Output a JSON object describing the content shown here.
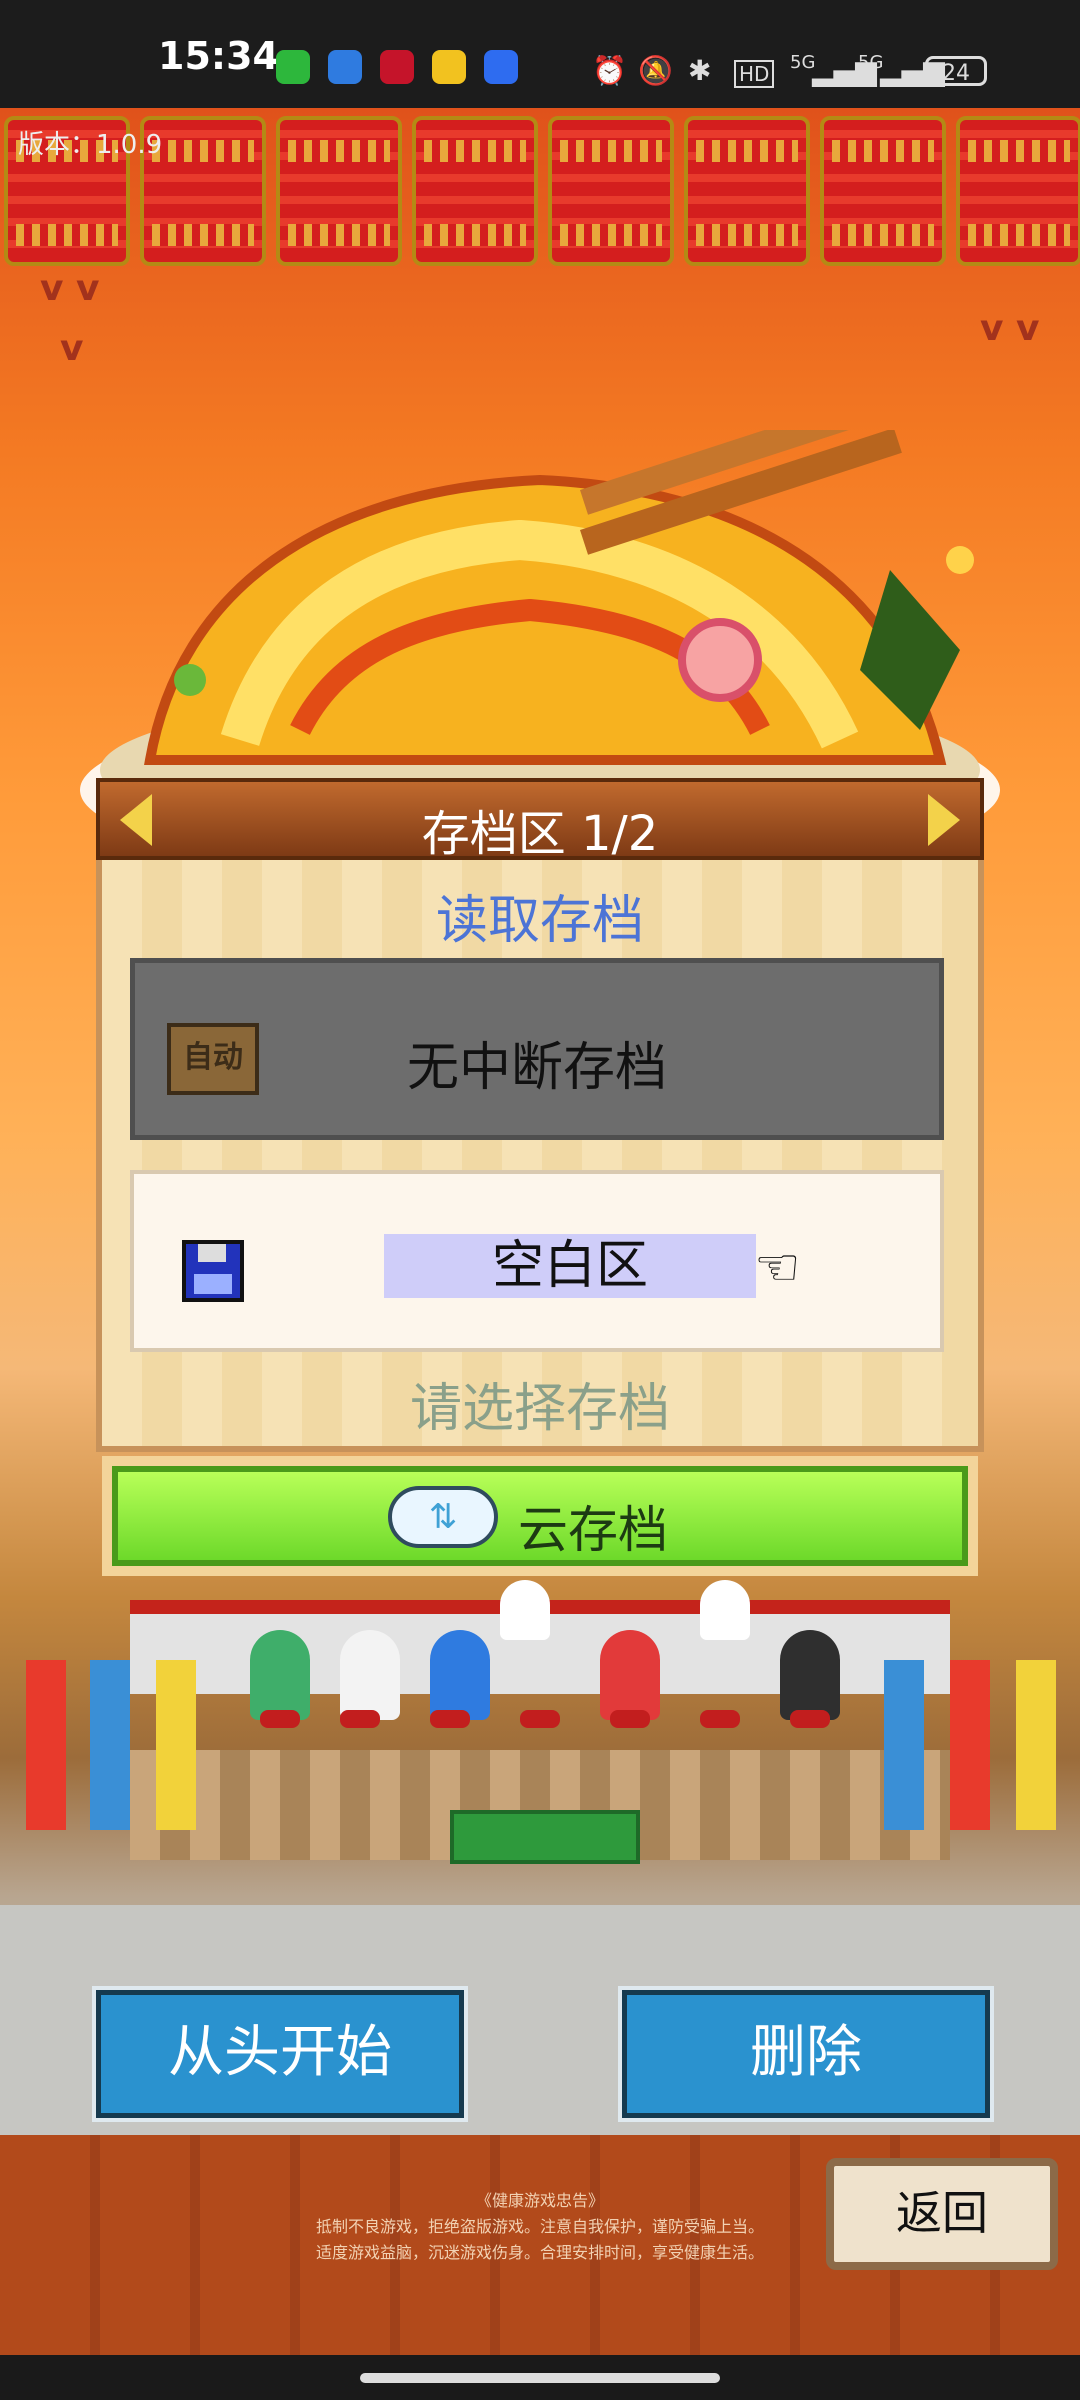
{
  "status_bar": {
    "time": "15:34",
    "network_1": "5G",
    "network_2": "5G",
    "battery": "24",
    "icons": [
      "wechat-icon",
      "weather-icon",
      "news-icon",
      "weibo-icon",
      "app-icon",
      "alarm-icon",
      "mute-icon",
      "bluetooth-icon",
      "hd-icon",
      "signal-icon",
      "signal-icon"
    ]
  },
  "version_label": "版本：1.0.9",
  "save_panel": {
    "header": "存档区 1/2",
    "load_title": "读取存档",
    "auto_slot_label": "无中断存档",
    "auto_icon_text": "自动",
    "empty_slot_label": "空白区",
    "select_hint": "请选择存档"
  },
  "cloud_button": {
    "label": "云存档"
  },
  "buttons": {
    "restart": "从头开始",
    "delete": "删除",
    "back": "返回"
  },
  "notice": {
    "title": "《健康游戏忠告》",
    "line1": "抵制不良游戏，拒绝盗版游戏。注意自我保护，谨防受骗上当。",
    "line2": "适度游戏益脑，沉迷游戏伤身。合理安排时间，享受健康生活。"
  },
  "colors": {
    "panel_title": "#4c74d6",
    "cloud_green": "#8ae63a",
    "blue_button": "#2a92cf"
  }
}
